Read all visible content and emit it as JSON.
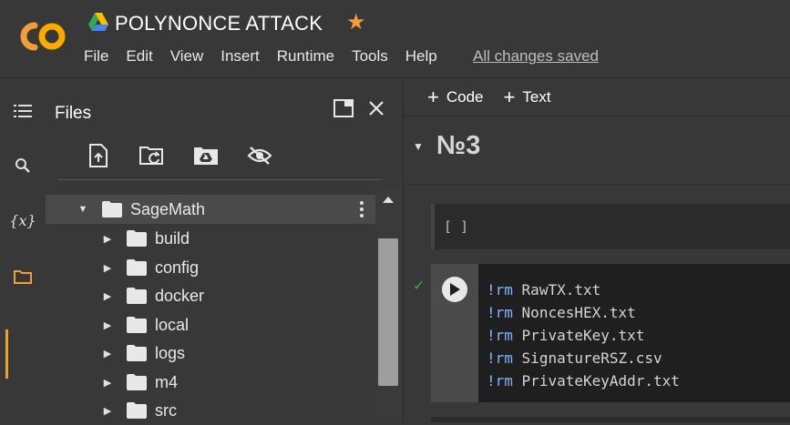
{
  "app": {
    "title": "POLYNONCE ATTACK",
    "save_status": "All changes saved",
    "accent": "#f29d38"
  },
  "menu": [
    "File",
    "Edit",
    "View",
    "Insert",
    "Runtime",
    "Tools",
    "Help"
  ],
  "rail": {
    "icons": [
      "table-of-contents-icon",
      "search-icon",
      "variables-icon",
      "folder-icon"
    ],
    "variables_glyph": "{x}"
  },
  "files_panel": {
    "title": "Files",
    "tools": [
      "upload-file-icon",
      "refresh-folder-icon",
      "mount-drive-icon",
      "hide-hidden-icon"
    ],
    "tree": [
      {
        "label": "SageMath",
        "expanded": true,
        "selected": true
      },
      {
        "label": "build",
        "expanded": false
      },
      {
        "label": "config",
        "expanded": false
      },
      {
        "label": "docker",
        "expanded": false
      },
      {
        "label": "local",
        "expanded": false
      },
      {
        "label": "logs",
        "expanded": false
      },
      {
        "label": "m4",
        "expanded": false
      },
      {
        "label": "src",
        "expanded": false
      }
    ]
  },
  "notebook": {
    "toolbar": {
      "add_code": "Code",
      "add_text": "Text"
    },
    "section_title": "№3",
    "empty_cell": "[ ]",
    "code_lines": [
      {
        "cmd": "!rm",
        "arg": "RawTX.txt"
      },
      {
        "cmd": "!rm",
        "arg": "NoncesHEX.txt"
      },
      {
        "cmd": "!rm",
        "arg": "PrivateKey.txt"
      },
      {
        "cmd": "!rm",
        "arg": "SignatureRSZ.csv"
      },
      {
        "cmd": "!rm",
        "arg": "PrivateKeyAddr.txt"
      }
    ]
  }
}
